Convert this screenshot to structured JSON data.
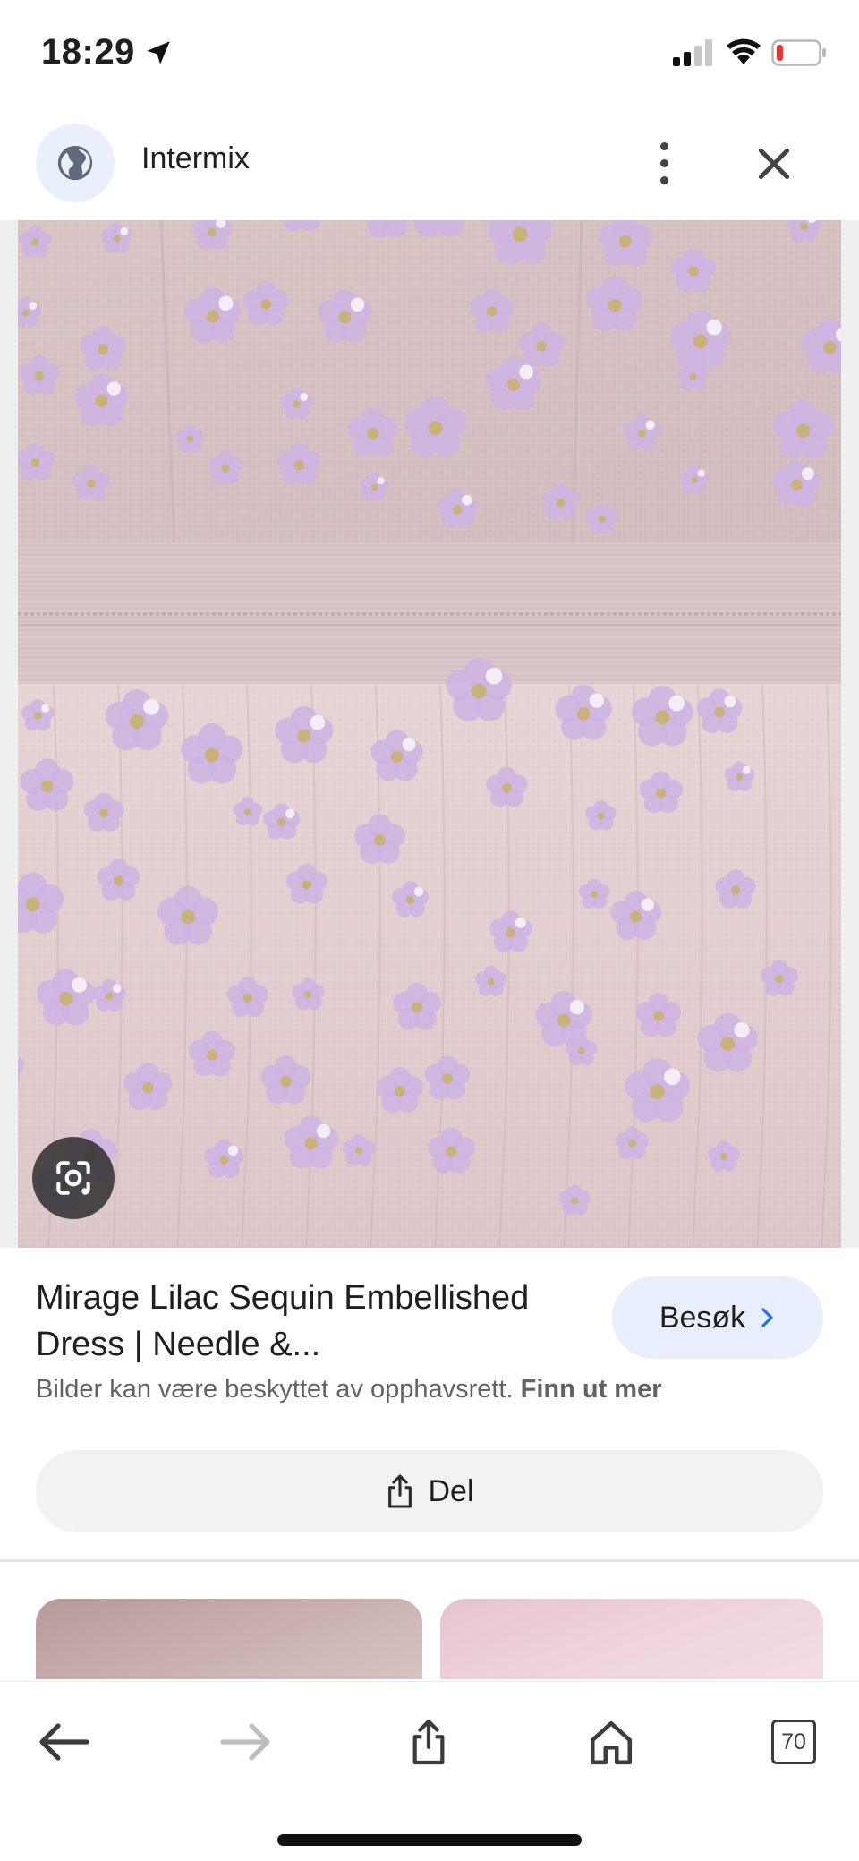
{
  "status_bar": {
    "time": "18:29",
    "battery_color": "#e53935"
  },
  "header": {
    "site_name": "Intermix"
  },
  "image": {
    "alt": "Mirage Lilac Sequin Embellished Dress",
    "fabric_color": "#d9c5c7",
    "flower_color": "#cdb4e3",
    "center_color": "#c9b27a"
  },
  "result": {
    "title": "Mirage Lilac Sequin Embellished Dress | Needle &...",
    "visit_label": "Besøk",
    "copyright_text": "Bilder kan være beskyttet av opphavsrett.",
    "learn_more": "Finn ut mer",
    "share_label": "Del"
  },
  "toolbar": {
    "tab_count": "70"
  },
  "icons": [
    "location-arrow-icon",
    "signal-icon",
    "wifi-icon",
    "battery-icon",
    "globe-icon",
    "more-vert-icon",
    "close-icon",
    "lens-icon",
    "chevron-right-icon",
    "share-icon",
    "back-icon",
    "forward-icon",
    "home-icon",
    "tabs-icon"
  ]
}
